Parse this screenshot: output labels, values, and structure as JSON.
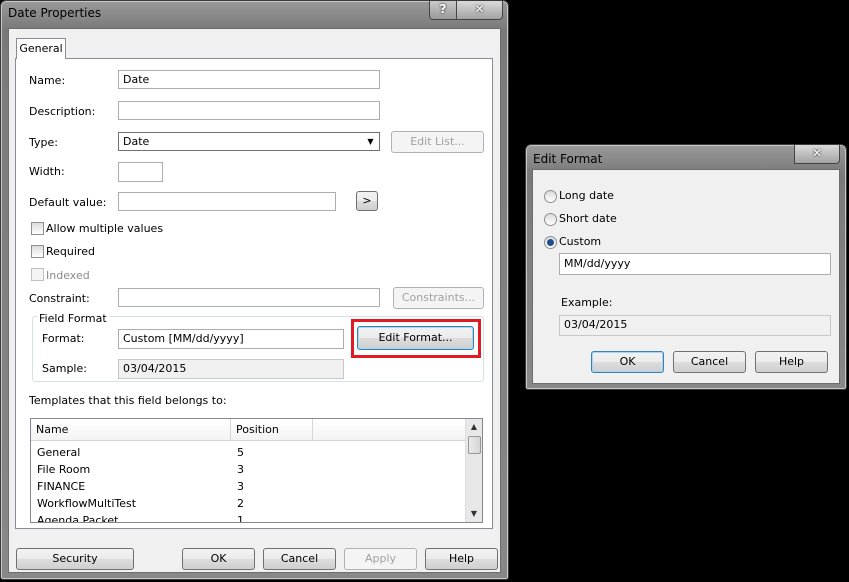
{
  "main": {
    "title": "Date Properties",
    "help_glyph": "?",
    "close_glyph": "✕",
    "tab": "General",
    "fields": {
      "name_label": "Name:",
      "name_value": "Date",
      "description_label": "Description:",
      "description_value": "",
      "type_label": "Type:",
      "type_value": "Date",
      "type_arrow": "▼",
      "edit_list_button": "Edit List...",
      "width_label": "Width:",
      "width_value": "",
      "default_label": "Default value:",
      "default_value": "",
      "default_button": ">",
      "allow_multiple_label": "Allow multiple values",
      "required_label": "Required",
      "indexed_label": "Indexed",
      "constraint_label": "Constraint:",
      "constraint_value": "",
      "constraints_button": "Constraints..."
    },
    "field_format": {
      "group_label": "Field Format",
      "format_label": "Format:",
      "format_value": "Custom [MM/dd/yyyy]",
      "edit_format_button": "Edit Format...",
      "sample_label": "Sample:",
      "sample_value": "03/04/2015"
    },
    "templates": {
      "label": "Templates that this field belongs to:",
      "columns": [
        "Name",
        "Position"
      ],
      "rows": [
        {
          "name": "General",
          "position": "5"
        },
        {
          "name": "File Room",
          "position": "3"
        },
        {
          "name": "FINANCE",
          "position": "3"
        },
        {
          "name": "WorkflowMultiTest",
          "position": "2"
        },
        {
          "name": "Agenda Packet",
          "position": "1"
        }
      ],
      "scroll_up": "▲",
      "scroll_down": "▼"
    },
    "buttons": {
      "security": "Security",
      "ok": "OK",
      "cancel": "Cancel",
      "apply": "Apply",
      "help": "Help"
    },
    "highlight_color": "#e01b22"
  },
  "edit_format": {
    "title": "Edit Format",
    "close_glyph": "✕",
    "options": {
      "long_date": "Long date",
      "short_date": "Short date",
      "custom": "Custom"
    },
    "selected": "custom",
    "custom_value": "MM/dd/yyyy",
    "example_label": "Example:",
    "example_value": "03/04/2015",
    "buttons": {
      "ok": "OK",
      "cancel": "Cancel",
      "help": "Help"
    }
  }
}
